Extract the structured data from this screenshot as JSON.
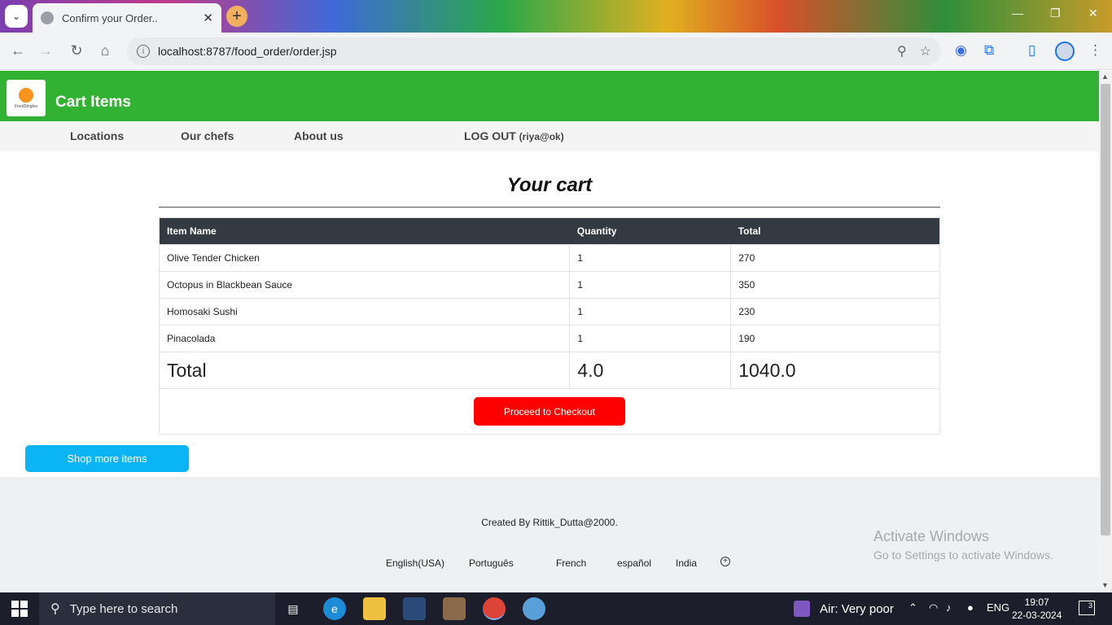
{
  "browser": {
    "tab_title": "Confirm your Order..",
    "url": "localhost:8787/food_order/order.jsp"
  },
  "site": {
    "logo_text": "FoodSingles",
    "title": "Cart Items",
    "nav": {
      "locations": "Locations",
      "chefs": "Our chefs",
      "about": "About us",
      "logout": "LOG OUT",
      "user": "(riya@ok)"
    }
  },
  "cart": {
    "heading": "Your cart",
    "columns": [
      "Item Name",
      "Quantity",
      "Total"
    ],
    "items": [
      {
        "name": "Olive Tender Chicken",
        "qty": "1",
        "total": "270"
      },
      {
        "name": "Octopus in Blackbean Sauce",
        "qty": "1",
        "total": "350"
      },
      {
        "name": "Homosaki Sushi",
        "qty": "1",
        "total": "230"
      },
      {
        "name": "Pinacolada",
        "qty": "1",
        "total": "190"
      }
    ],
    "total_label": "Total",
    "total_qty": "4.0",
    "total_amount": "1040.0",
    "checkout_label": "Proceed to Checkout"
  },
  "shop_more_label": "Shop more items",
  "footer": {
    "credit": "Created By Rittik_Dutta@2000.",
    "languages": [
      "English(USA)",
      "Português",
      "French",
      "español",
      "India"
    ]
  },
  "watermark": {
    "line1": "Activate Windows",
    "line2": "Go to Settings to activate Windows."
  },
  "taskbar": {
    "search_placeholder": "Type here to search",
    "weather": "Air: Very poor",
    "lang": "ENG",
    "time": "19:07",
    "date": "22-03-2024",
    "notifications": "3"
  },
  "colors": {
    "header_green": "#32b232",
    "checkout_red": "#ff0000",
    "shop_more_blue": "#0bb4f5",
    "table_header": "#333a42"
  }
}
